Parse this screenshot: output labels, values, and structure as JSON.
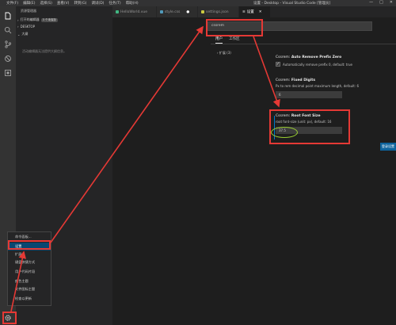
{
  "titlebar": {
    "menu": [
      "文件(F)",
      "编辑(E)",
      "选择(S)",
      "查看(V)",
      "转到(G)",
      "调试(D)",
      "任务(T)",
      "帮助(H)"
    ],
    "window_title": "设置 - Desktop - Visual Studio Code [管理员]",
    "controls": [
      "—",
      "□",
      "✕"
    ]
  },
  "activity": {
    "icons": [
      "files-icon",
      "search-icon",
      "source-control-icon",
      "debug-icon",
      "extensions-icon",
      "gear-icon"
    ]
  },
  "sidebar": {
    "title": "资源管理器",
    "sections": [
      {
        "label": "打开的编辑器",
        "badge": "3 个未保存"
      },
      {
        "label": "DESKTOP",
        "badge": ""
      },
      {
        "label": "大纲",
        "badge": ""
      }
    ],
    "outline_message": "活动编辑器无法提供大纲信息。"
  },
  "tabs": [
    {
      "label": "HelloWorld.vue",
      "color": "#41b883"
    },
    {
      "label": "style.css",
      "color": "#519aba"
    },
    {
      "label": "settings.json",
      "color": "#cbcb41"
    },
    {
      "label": "设置",
      "color": "#cccccc"
    }
  ],
  "settings": {
    "search_value": "cssrem",
    "scopes": [
      "用户",
      "工作区"
    ],
    "toc_item": "› 扩展 (3)",
    "items": [
      {
        "category": "Cssrem:",
        "name": "Auto Remove Prefix Zero",
        "checkbox_checked": true,
        "checkbox_label": "Automatically remove prefix 0, default: true"
      },
      {
        "category": "Cssrem:",
        "name": "Fixed Digits",
        "description": "Px to rem decimal point maximum length, default: 6",
        "value": "6"
      },
      {
        "category": "Cssrem:",
        "name": "Root Font Size",
        "description": "root font-size (unit: px), default: 16",
        "value": "37.5"
      }
    ],
    "login_button": "登录设置"
  },
  "context_menu": {
    "items": [
      "命令面板...",
      "设置",
      "扩展",
      "键盘快捷方式",
      "用户代码片段",
      "颜色主题",
      "文件图标主题",
      "检查以更新"
    ],
    "highlighted": "设置"
  },
  "annotation_colors": {
    "box": "#e53935",
    "ellipse": "#9acd32",
    "accent": "#007acc"
  }
}
